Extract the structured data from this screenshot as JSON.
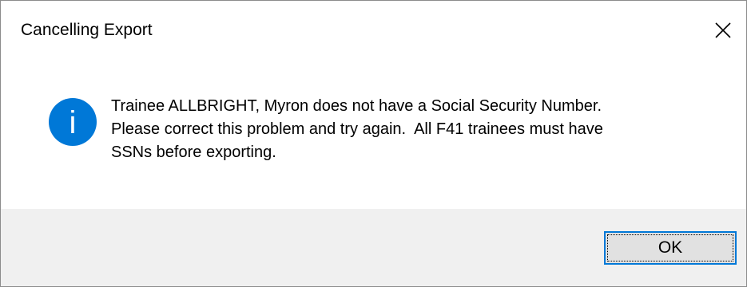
{
  "dialog": {
    "title": "Cancelling Export",
    "close_icon": "close-icon",
    "icon": "info-icon",
    "icon_glyph": "i",
    "accent_color": "#0078d7",
    "message": "Trainee ALLBRIGHT, Myron does not have a Social Security Number.\nPlease correct this problem and try again.  All F41 trainees must have\nSSNs before exporting.",
    "ok_label": "OK"
  }
}
